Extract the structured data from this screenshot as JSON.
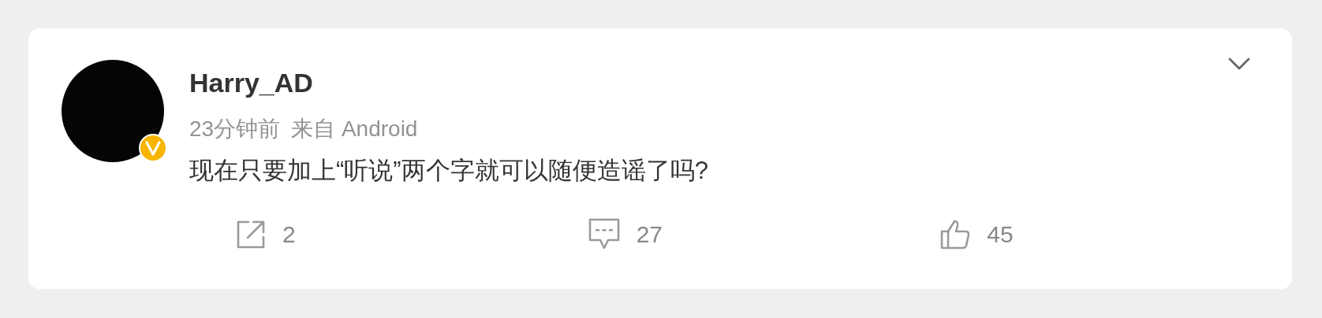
{
  "post": {
    "author": "Harry_AD",
    "verified": true,
    "time": "23分钟前",
    "source": "来自 Android",
    "text": "现在只要加上“听说”两个字就可以随便造谣了吗?",
    "actions": [
      {
        "kind": "share",
        "count": "2"
      },
      {
        "kind": "comment",
        "count": "27"
      },
      {
        "kind": "like",
        "count": "45"
      }
    ]
  }
}
